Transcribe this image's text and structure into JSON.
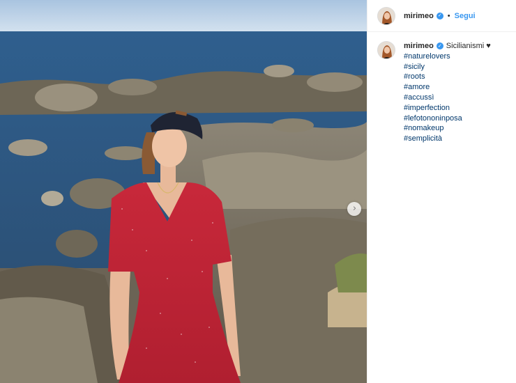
{
  "post": {
    "author": "mirimeo",
    "follow_label": "Segui",
    "separator": "•",
    "verified_icon": "verified-badge-icon",
    "caption_text": "Sicilianismi ♥",
    "hashtags": [
      "#naturelovers",
      "#sicily",
      "#roots",
      "#amore",
      "#accussì",
      "#imperfection",
      "#lefotononinposa",
      "#nomakeup",
      "#semplicità"
    ],
    "next_icon": "chevron-right-icon"
  },
  "colors": {
    "link_blue": "#3897f0",
    "hashtag_blue": "#00376b",
    "text": "#262626"
  }
}
